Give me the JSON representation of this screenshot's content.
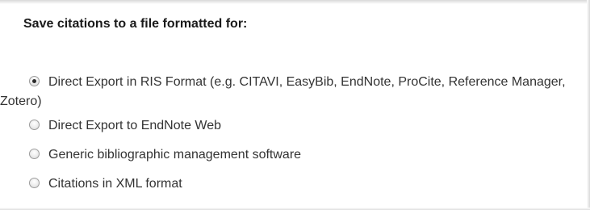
{
  "dialog": {
    "heading": "Save citations to a file formatted for:"
  },
  "options": [
    {
      "label": "Direct Export in RIS Format (e.g. CITAVI, EasyBib, EndNote, ProCite, Reference Manager, Zotero)",
      "selected": true
    },
    {
      "label": "Direct Export to EndNote Web",
      "selected": false
    },
    {
      "label": "Generic bibliographic management software",
      "selected": false
    },
    {
      "label": "Citations in XML format",
      "selected": false
    }
  ]
}
